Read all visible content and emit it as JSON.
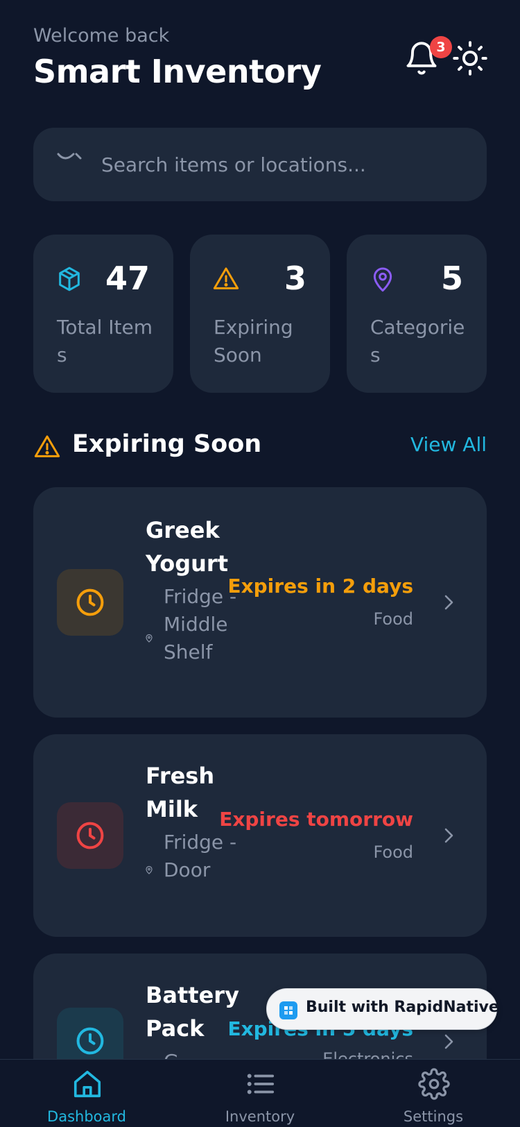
{
  "header": {
    "welcome": "Welcome back",
    "title": "Smart Inventory",
    "notification_count": "3",
    "bell_icon": "bell-icon",
    "theme_icon": "sun-icon"
  },
  "search": {
    "placeholder": "Search items or locations...",
    "value": ""
  },
  "stats": [
    {
      "value": "47",
      "label": "Total Items",
      "icon": "box-icon",
      "color": "#22b8e0"
    },
    {
      "value": "3",
      "label": "Expiring Soon",
      "icon": "warning-icon",
      "color": "#f59e0b"
    },
    {
      "value": "5",
      "label": "Categories",
      "icon": "map-pin-icon",
      "color": "#8b5cf6"
    }
  ],
  "section": {
    "title": "Expiring Soon",
    "view_all": "View All",
    "icon": "warning-icon"
  },
  "items": [
    {
      "name": "Greek Yogurt",
      "location": "Fridge - Middle Shelf",
      "status": "Expires in 2 days",
      "category": "Food",
      "status_color": "#f59e0b"
    },
    {
      "name": "Fresh Milk",
      "location": "Fridge - Door",
      "status": "Expires tomorrow",
      "category": "Food",
      "status_color": "#ef4444"
    },
    {
      "name": "Battery Pack",
      "location": "G",
      "status": "Expires in 5 days",
      "category": "Electronics",
      "status_color": "#22b8e0"
    }
  ],
  "promo": {
    "text": "Built with RapidNative"
  },
  "tabs": [
    {
      "label": "Dashboard",
      "icon": "home-icon",
      "active": true
    },
    {
      "label": "Inventory",
      "icon": "list-icon",
      "active": false
    },
    {
      "label": "Settings",
      "icon": "gear-icon",
      "active": false
    }
  ],
  "colors": {
    "background": "#0f172a",
    "card": "#1e293b",
    "accent": "#22b8e0",
    "warning": "#f59e0b",
    "danger": "#ef4444",
    "purple": "#8b5cf6"
  }
}
